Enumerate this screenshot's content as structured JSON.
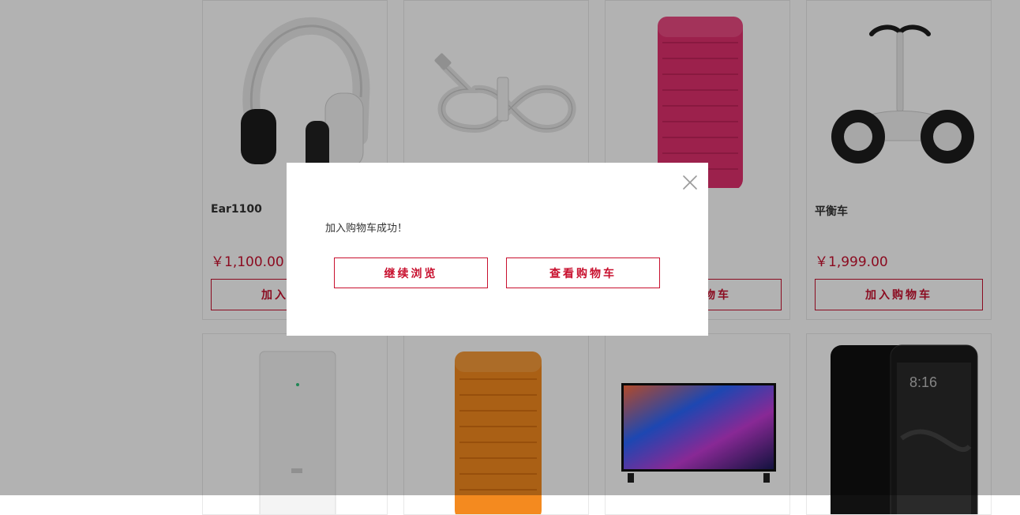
{
  "products": [
    {
      "name": "Ear1100",
      "price": "￥1,100.00",
      "button": "加入购物车",
      "icon": "headphones-icon"
    },
    {
      "name": "",
      "price": "",
      "button": "",
      "icon": "usb-cable-icon"
    },
    {
      "name": "",
      "price": "",
      "button": "加入购物车",
      "icon": "pink-speaker-icon"
    },
    {
      "name": "平衡车",
      "price": "￥1,999.00",
      "button": "加入购物车",
      "icon": "balance-scooter-icon"
    },
    {
      "name": "",
      "price": "",
      "button": "",
      "icon": "router-icon"
    },
    {
      "name": "",
      "price": "",
      "button": "",
      "icon": "orange-speaker-icon"
    },
    {
      "name": "",
      "price": "",
      "button": "",
      "icon": "tv-icon"
    },
    {
      "name": "",
      "price": "",
      "button": "",
      "icon": "phone-icon"
    }
  ],
  "modal": {
    "message": "加入购物车成功！",
    "continue_label": "继续浏览",
    "view_cart_label": "查看购物车",
    "close_icon": "close-icon"
  },
  "colors": {
    "accent": "#c8102e",
    "overlay": "rgba(0,0,0,0.30)"
  }
}
